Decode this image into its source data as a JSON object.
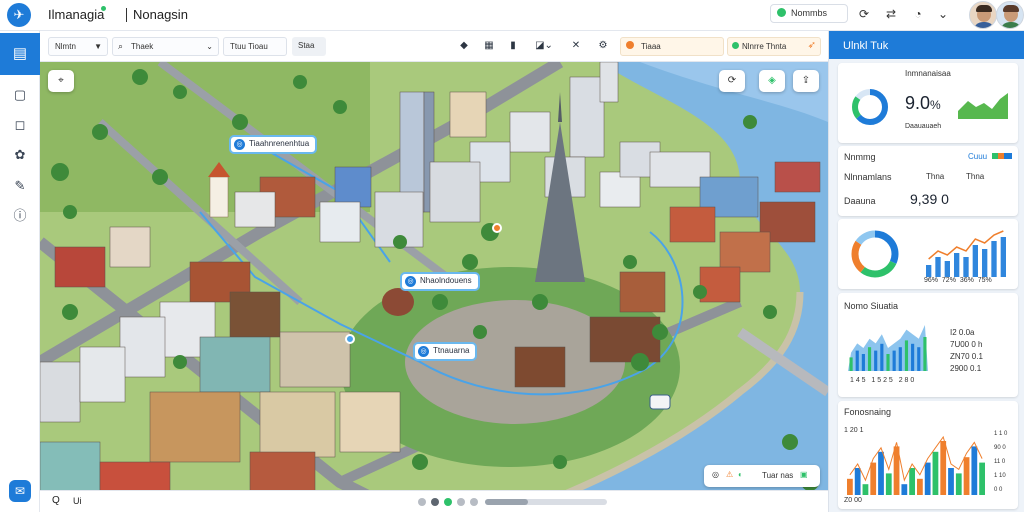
{
  "topbar": {
    "app_title": "Ilmanagia",
    "app_subtitle": "Nonagsin",
    "status_label": "Nommbs",
    "icons": [
      "logo-icon",
      "refresh-icon",
      "sync-icon",
      "notification-icon",
      "chevron-down-icon"
    ]
  },
  "sidebar": {
    "items": [
      {
        "icon": "map-layers-icon",
        "active": true
      },
      {
        "icon": "document-icon"
      },
      {
        "icon": "bell-icon"
      },
      {
        "icon": "puzzle-icon"
      },
      {
        "icon": "edit-icon"
      },
      {
        "icon": "info-icon"
      }
    ],
    "bottom_icon": "chat-icon"
  },
  "toolbar": {
    "view_select": "Nlmtn",
    "search_value": "Thaek",
    "filter_value": "Ttuu Tioau",
    "layer_label": "Staa",
    "location_value": "Tiaaa",
    "alert_value": "Nlnrre Thnta"
  },
  "map": {
    "callouts": [
      "Tiaahnrenenhtua",
      "Nhaolndouens",
      "Ttnauarna"
    ],
    "footer_label": "Tuar nas"
  },
  "right_panel": {
    "header": "Ulnkl  Tuk",
    "kpi": {
      "title": "Inmnanaisaa",
      "value": "9.0",
      "unit": "%",
      "caption": "Daauauaeh"
    },
    "stats": {
      "title": "Nnmmg",
      "title_tag": "Cuuu",
      "row1_label": "Nlnnamlans",
      "row1_tag": "Thna",
      "row2_label": "Daauna",
      "row2_value": "9,39 0",
      "pct_labels": [
        "96%",
        "72%",
        "36%",
        "75%"
      ]
    },
    "chart1": {
      "values": [
        3,
        5,
        4,
        6,
        5,
        8,
        7,
        9,
        10
      ]
    },
    "chart2": {
      "title": "Nomo Siuatia",
      "labels": [
        "I2 0.0a",
        "7U00 0 h",
        "ZN70 0.1",
        "2900 0.1"
      ],
      "ticks": [
        "1 4 5",
        "1 5 2 5",
        "2 8 0"
      ],
      "values": [
        4,
        6,
        5,
        7,
        6,
        8,
        5,
        6,
        7,
        9,
        8,
        7,
        10
      ]
    },
    "chart3": {
      "title": "Fonosnaing",
      "ticks": [
        "1 20 1",
        "Z0 00"
      ],
      "right_ticks": [
        "1 1 0",
        "90 0",
        "11 0",
        "1 10",
        "0 0"
      ],
      "values": [
        3,
        5,
        2,
        6,
        8,
        4,
        9,
        2,
        5,
        3,
        6,
        8,
        10,
        5,
        4,
        7,
        9,
        6
      ]
    }
  },
  "bottom_bar": {
    "progress": 0.35,
    "left_label": "Q",
    "right_label": "Ui"
  }
}
